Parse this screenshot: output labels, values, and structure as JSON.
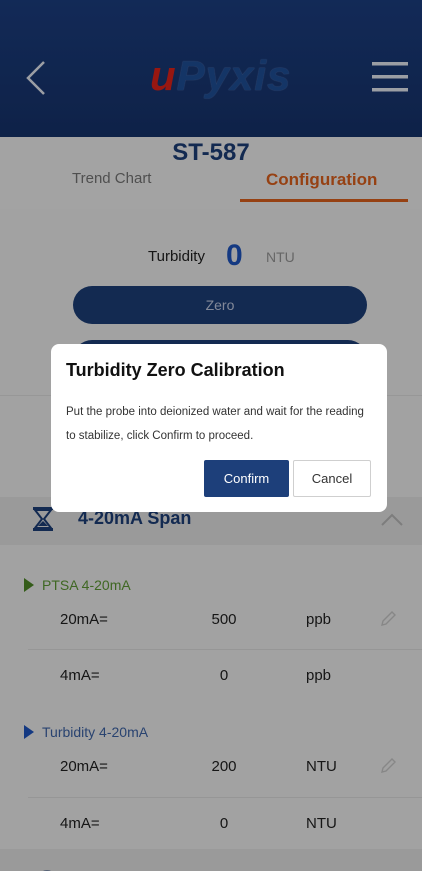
{
  "header": {
    "logo_u": "u",
    "logo_rest": "Pyxis",
    "back_icon": "chevron-left-icon",
    "menu_icon": "hamburger-menu-icon"
  },
  "device": {
    "name": "ST-587"
  },
  "tabs": [
    {
      "label": "Trend Chart",
      "active": false
    },
    {
      "label": "Configuration",
      "active": true
    }
  ],
  "turbidity": {
    "label": "Turbidity",
    "value": "0",
    "unit": "NTU"
  },
  "buttons": {
    "zero": "Zero"
  },
  "span": {
    "title": "4-20mA Span"
  },
  "groups": [
    {
      "label": "PTSA 4-20mA",
      "rows": [
        {
          "name": "20mA=",
          "value": "500",
          "unit": "ppb"
        },
        {
          "name": "4mA=",
          "value": "0",
          "unit": "ppb"
        }
      ]
    },
    {
      "label": "Turbidity 4-20mA",
      "rows": [
        {
          "name": "20mA=",
          "value": "200",
          "unit": "NTU"
        },
        {
          "name": "4mA=",
          "value": "0",
          "unit": "NTU"
        }
      ]
    }
  ],
  "dialog": {
    "title": "Turbidity Zero Calibration",
    "message": "Put the probe into deionized water and wait for the reading to stabilize, click Confirm to proceed.",
    "confirm": "Confirm",
    "cancel": "Cancel"
  },
  "colors": {
    "primary": "#1d3f7a",
    "accent": "#e0621d",
    "ptsa": "#5e9a34",
    "turbidity_group": "#3e64a8"
  }
}
